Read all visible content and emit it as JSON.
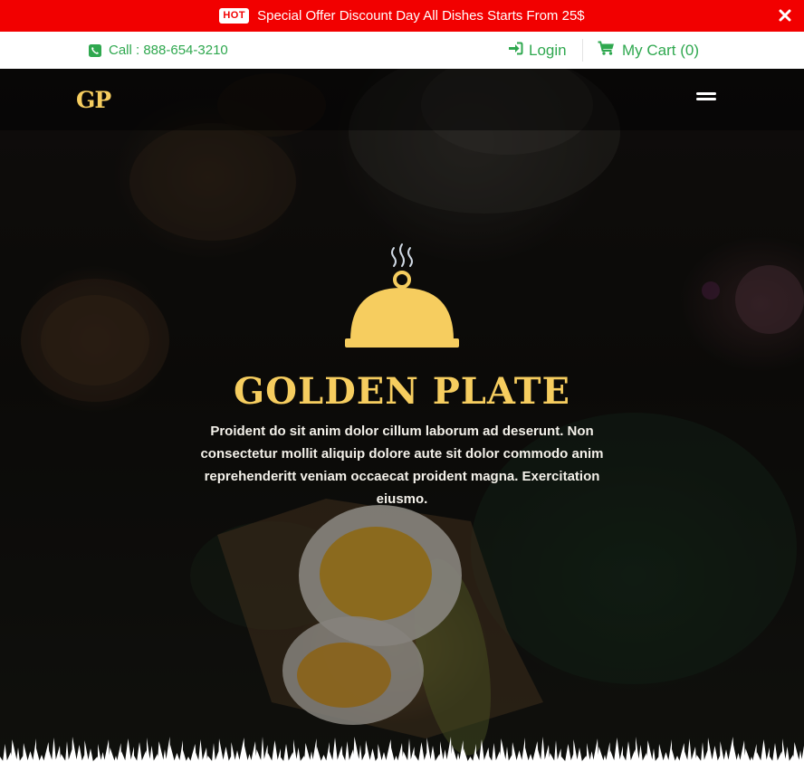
{
  "promo": {
    "badge": "HOT",
    "text": "Special Offer Discount Day All Dishes Starts From 25$",
    "close_icon": "close-icon"
  },
  "utility": {
    "phone_label": "Call : 888-654-3210",
    "login_label": "Login",
    "cart_label": "My Cart (0)",
    "phone_icon": "phone-square-icon",
    "login_icon": "sign-in-icon",
    "cart_icon": "shopping-cart-icon"
  },
  "navbar": {
    "logo": "GP",
    "menu_icon": "hamburger-menu-icon"
  },
  "hero": {
    "icon": "serving-cloche-icon",
    "title": "GOLDEN PLATE",
    "description": "Proident do sit anim dolor cillum laborum ad deserunt. Non consectetur mollit aliquip dolore aute sit dolor commodo anim reprehenderitt veniam occaecat proident magna. Exercitation eiusmo."
  },
  "colors": {
    "promo_bg": "#f20000",
    "accent_green": "#2fa84f",
    "brand_gold": "#f6cd5f",
    "hero_text": "#f4f1ea"
  }
}
